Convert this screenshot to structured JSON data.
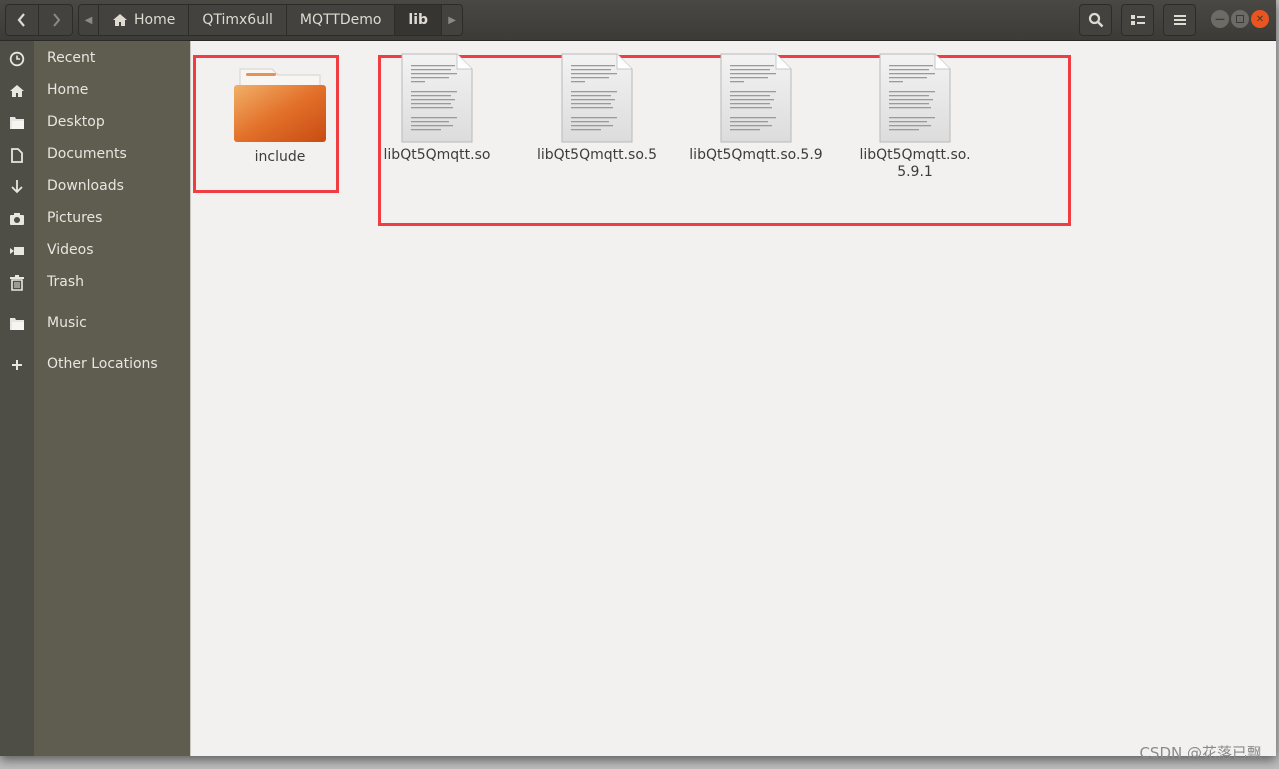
{
  "header": {
    "nav": {
      "back_icon": "chevron-left-icon",
      "forward_icon": "chevron-right-icon"
    },
    "breadcrumbs": [
      {
        "label": "Home",
        "icon": "home-icon"
      },
      {
        "label": "QTimx6ull"
      },
      {
        "label": "MQTTDemo"
      },
      {
        "label": "lib",
        "active": true
      }
    ],
    "tools": [
      "search-icon",
      "view-toggle-icon",
      "menu-icon"
    ],
    "window_controls": [
      "minimize",
      "maximize",
      "close"
    ]
  },
  "sidebar": {
    "items": [
      {
        "label": "Recent",
        "icon": "clock-icon"
      },
      {
        "label": "Home",
        "icon": "home-icon"
      },
      {
        "label": "Desktop",
        "icon": "folder-icon"
      },
      {
        "label": "Documents",
        "icon": "document-icon"
      },
      {
        "label": "Downloads",
        "icon": "download-icon"
      },
      {
        "label": "Pictures",
        "icon": "camera-icon"
      },
      {
        "label": "Videos",
        "icon": "video-icon"
      },
      {
        "label": "Trash",
        "icon": "trash-icon"
      },
      {
        "label": "Music",
        "icon": "folder-icon"
      },
      {
        "label": "Other Locations",
        "icon": "plus-icon"
      }
    ]
  },
  "files": [
    {
      "name": "include",
      "type": "folder"
    },
    {
      "name": "libQt5Qmqtt.so",
      "type": "file"
    },
    {
      "name": "libQt5Qmqtt.so.5",
      "type": "file"
    },
    {
      "name": "libQt5Qmqtt.so.5.9",
      "type": "file"
    },
    {
      "name": "libQt5Qmqtt.so.\n5.9.1",
      "type": "file"
    }
  ],
  "colors": {
    "highlight_box": "#ef3d42",
    "close_button": "#e95420"
  },
  "watermark": "CSDN @花落已飘"
}
